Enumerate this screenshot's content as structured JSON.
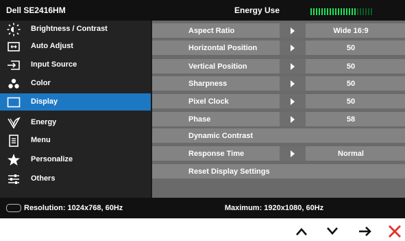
{
  "header": {
    "model": "Dell SE2416HM",
    "section_title": "Energy Use",
    "energy_meter": {
      "total_segments": 23,
      "lit_segments": 17,
      "lit_color": "#1ee05a",
      "unlit_color": "#0b5a24"
    }
  },
  "sidebar": {
    "items": [
      {
        "label": "Brightness / Contrast",
        "icon": "brightness-icon",
        "active": false
      },
      {
        "label": "Auto Adjust",
        "icon": "auto-adjust-icon",
        "active": false
      },
      {
        "label": "Input Source",
        "icon": "input-source-icon",
        "active": false
      },
      {
        "label": "Color",
        "icon": "color-icon",
        "active": false
      },
      {
        "label": "Display",
        "icon": "display-icon",
        "active": true
      },
      {
        "label": "Energy",
        "icon": "energy-icon",
        "active": false
      },
      {
        "label": "Menu",
        "icon": "menu-icon",
        "active": false
      },
      {
        "label": "Personalize",
        "icon": "star-icon",
        "active": false
      },
      {
        "label": "Others",
        "icon": "sliders-icon",
        "active": false
      }
    ],
    "active_color": "#1d78c4"
  },
  "panel": {
    "rows": [
      {
        "label": "Aspect Ratio",
        "value": "Wide 16:9"
      },
      {
        "label": "Horizontal Position",
        "value": "50"
      },
      {
        "label": "Vertical Position",
        "value": "50"
      },
      {
        "label": "Sharpness",
        "value": "50"
      },
      {
        "label": "Pixel Clock",
        "value": "50"
      },
      {
        "label": "Phase",
        "value": "58"
      },
      {
        "label": "Dynamic Contrast",
        "value": ""
      },
      {
        "label": "Response Time",
        "value": "Normal"
      },
      {
        "label": "Reset Display Settings",
        "value": ""
      }
    ]
  },
  "footer": {
    "resolution": "Resolution: 1024x768, 60Hz",
    "maximum": "Maximum: 1920x1080, 60Hz"
  },
  "nav_buttons": [
    {
      "name": "up-button",
      "icon": "chevron-up-icon",
      "color": "#111111"
    },
    {
      "name": "down-button",
      "icon": "chevron-down-icon",
      "color": "#111111"
    },
    {
      "name": "enter-button",
      "icon": "arrow-right-icon",
      "color": "#111111"
    },
    {
      "name": "exit-button",
      "icon": "close-icon",
      "color": "#e53027"
    }
  ]
}
